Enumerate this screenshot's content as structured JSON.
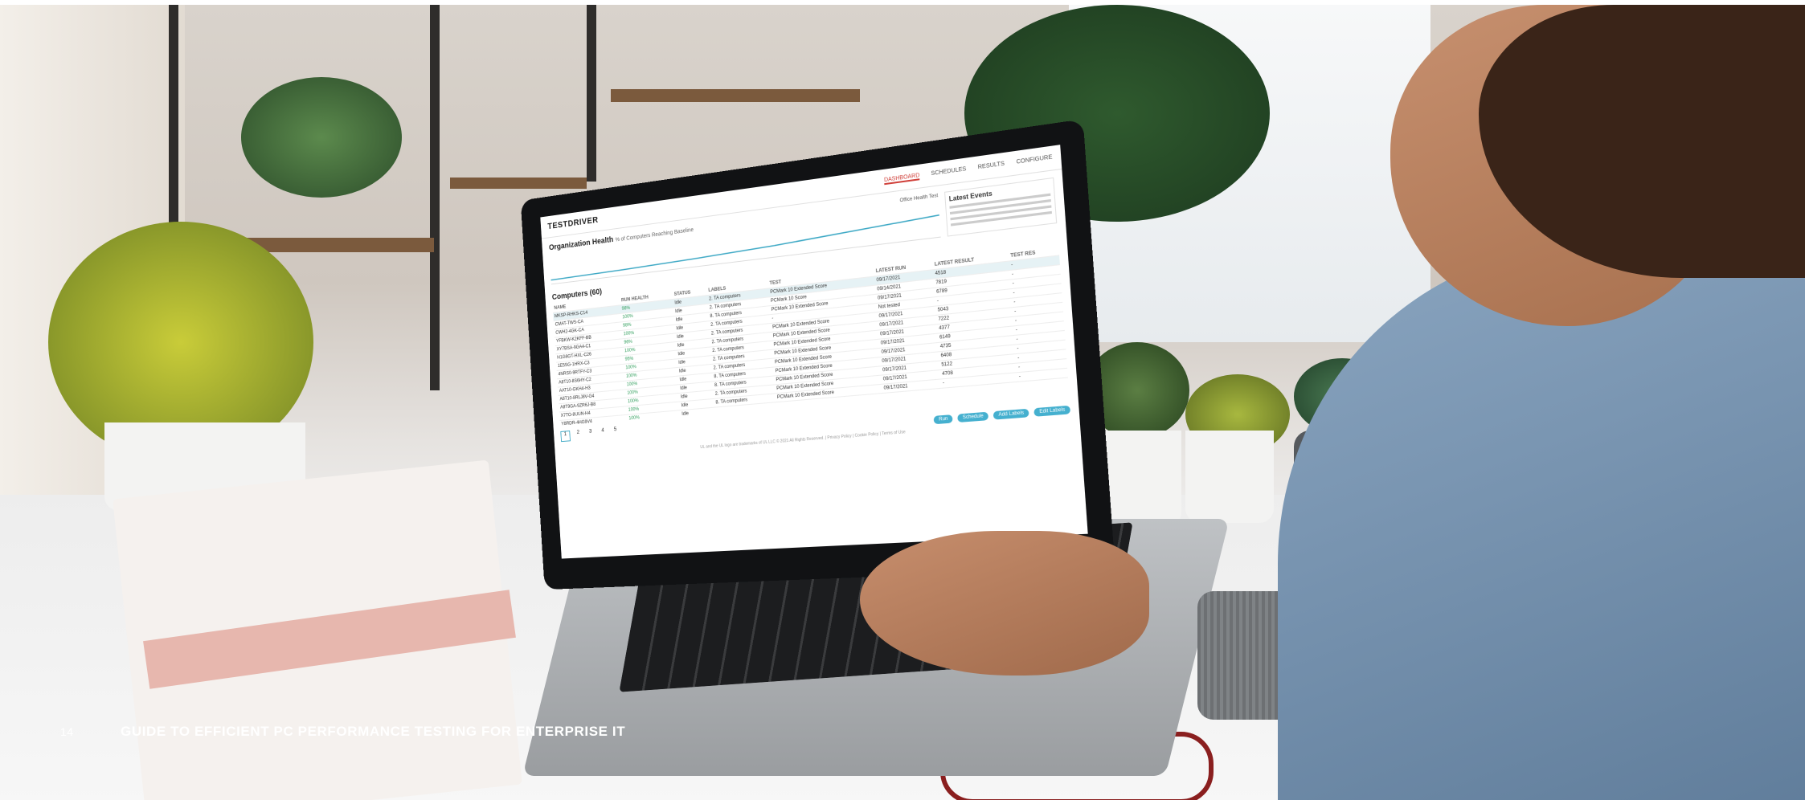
{
  "footer": {
    "page_number": "14",
    "guide_title": "GUIDE TO EFFICIENT PC PERFORMANCE TESTING FOR ENTERPRISE IT"
  },
  "screen": {
    "logo": "TESTDRIVER",
    "nav": [
      "DASHBOARD",
      "SCHEDULES",
      "RESULTS",
      "CONFIGURE"
    ],
    "org_health": {
      "title": "Organization Health",
      "subtitle": "% of Computers Reaching Baseline",
      "test_select": "Office Health Test"
    },
    "latest_events": {
      "title": "Latest Events"
    },
    "computers": {
      "title": "Computers (60)",
      "columns": [
        "NAME",
        "RUN HEALTH",
        "STATUS",
        "LABELS",
        "TEST",
        "LATEST RUN",
        "LATEST RESULT",
        "TEST RES"
      ],
      "rows": [
        [
          "MKSP-RHKS-C14",
          "98%",
          "Idle",
          "2. TA computers",
          "PCMark 10 Extended Score",
          "09/17/2021",
          "4518",
          "-"
        ],
        [
          "CMAT-TWS-CA",
          "100%",
          "Idle",
          "2. TA computers",
          "PCMark 10 Score",
          "09/14/2021",
          "7819",
          "-"
        ],
        [
          "CWH2-4GK-CA",
          "98%",
          "Idle",
          "8. TA computers",
          "PCMark 10 Extended Score",
          "09/17/2021",
          "6789",
          "-"
        ],
        [
          "YFBKW-K2KFF-BB",
          "100%",
          "Idle",
          "2. TA computers",
          "-",
          "Not tested",
          "-",
          "-"
        ],
        [
          "XY7BSA-9GA4-C1",
          "96%",
          "Idle",
          "2. TA computers",
          "PCMark 10 Extended Score",
          "09/17/2021",
          "5043",
          "-"
        ],
        [
          "H1G8GT-HXL-C26",
          "100%",
          "Idle",
          "2. TA computers",
          "PCMark 10 Extended Score",
          "09/17/2021",
          "7222",
          "-"
        ],
        [
          "1E5SG-1HRX-C3",
          "95%",
          "Idle",
          "2. TA computers",
          "PCMark 10 Extended Score",
          "09/17/2021",
          "4377",
          "-"
        ],
        [
          "4NRS0-9RTFY-C3",
          "100%",
          "Idle",
          "2. TA computers",
          "PCMark 10 Extended Score",
          "09/17/2021",
          "6149",
          "-"
        ],
        [
          "A8T10-8S6HY-C2",
          "100%",
          "Idle",
          "2. TA computers",
          "PCMark 10 Extended Score",
          "09/17/2021",
          "4735",
          "-"
        ],
        [
          "AAT10-GKH4-H3",
          "100%",
          "Idle",
          "8. TA computers",
          "PCMark 10 Extended Score",
          "09/17/2021",
          "6408",
          "-"
        ],
        [
          "A8T10-8RLJ8V-G4",
          "100%",
          "Idle",
          "8. TA computers",
          "PCMark 10 Extended Score",
          "09/17/2021",
          "5122",
          "-"
        ],
        [
          "A8T9GA-9ZR6J-B8",
          "100%",
          "Idle",
          "2. TA computers",
          "PCMark 10 Extended Score",
          "09/17/2021",
          "4708",
          "-"
        ],
        [
          "X7TO-8UUN-H4",
          "100%",
          "Idle",
          "8. TA computers",
          "PCMark 10 Extended Score",
          "09/17/2021",
          "-",
          "-"
        ],
        [
          "Y8RDR-4HG9V4",
          "100%",
          "Idle",
          "",
          "",
          "",
          "",
          ""
        ]
      ],
      "pages": [
        "1",
        "2",
        "3",
        "4",
        "5"
      ],
      "buttons": [
        "Run",
        "Schedule",
        "Add Labels",
        "Edit Labels"
      ]
    },
    "copyright": "UL and the UL logo are trademarks of UL LLC © 2021 All Rights Reserved. | Privacy Policy | Cookie Policy | Terms of Use"
  }
}
